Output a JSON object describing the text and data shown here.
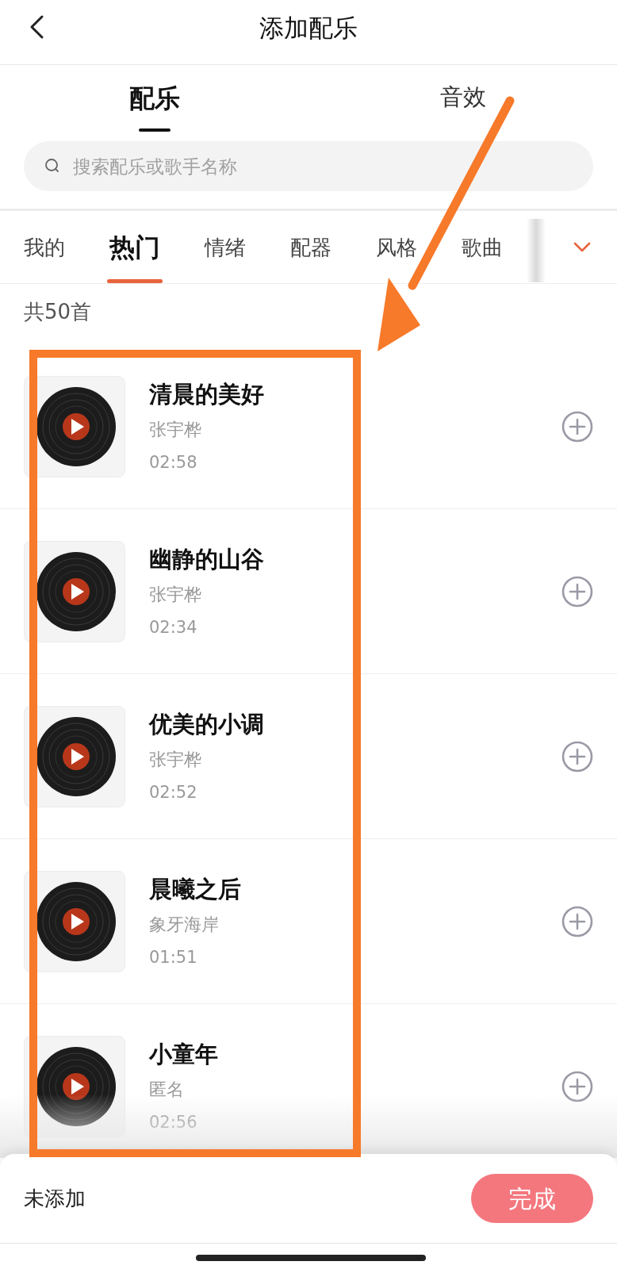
{
  "header": {
    "title": "添加配乐"
  },
  "top_tabs": [
    {
      "label": "配乐",
      "selected": true
    },
    {
      "label": "音效",
      "selected": false
    }
  ],
  "search": {
    "placeholder": "搜索配乐或歌手名称"
  },
  "categories": [
    {
      "label": "我的",
      "selected": false
    },
    {
      "label": "热门",
      "selected": true
    },
    {
      "label": "情绪",
      "selected": false
    },
    {
      "label": "配器",
      "selected": false
    },
    {
      "label": "风格",
      "selected": false
    },
    {
      "label": "歌曲",
      "selected": false
    }
  ],
  "count": "共50首",
  "tracks": [
    {
      "title": "清晨的美好",
      "artist": "张宇桦",
      "duration": "02:58"
    },
    {
      "title": "幽静的山谷",
      "artist": "张宇桦",
      "duration": "02:34"
    },
    {
      "title": "优美的小调",
      "artist": "张宇桦",
      "duration": "02:52"
    },
    {
      "title": "晨曦之后",
      "artist": "象牙海岸",
      "duration": "01:51"
    },
    {
      "title": "小童年",
      "artist": "匿名",
      "duration": "02:56"
    }
  ],
  "footer": {
    "status": "未添加",
    "button": "完成"
  }
}
